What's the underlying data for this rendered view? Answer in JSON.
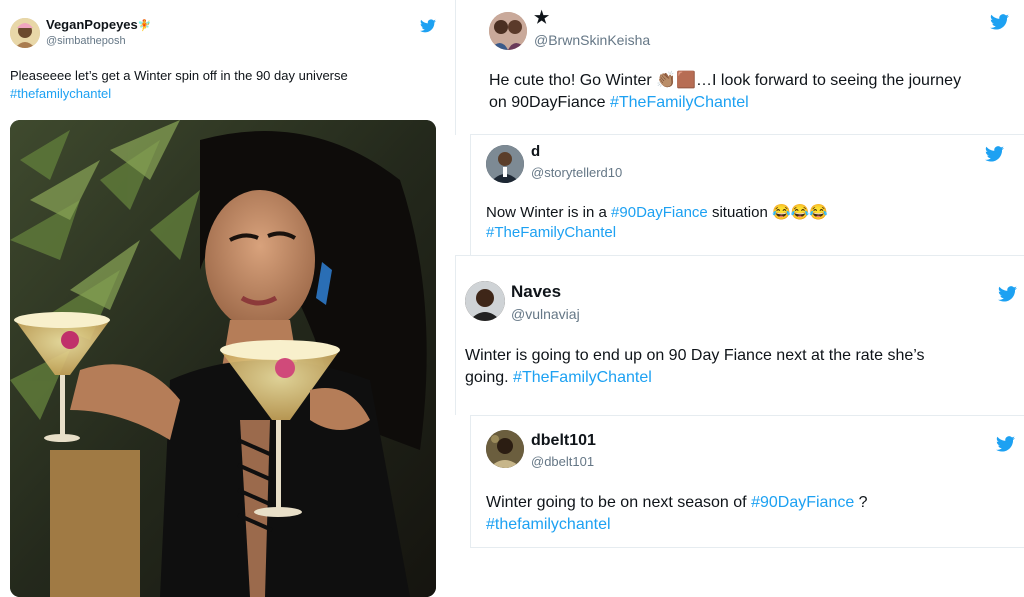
{
  "colors": {
    "accent": "#1da1f2",
    "muted": "#657786",
    "text": "#0f1419",
    "divider": "#e6ecf0"
  },
  "tweet1": {
    "name": "VeganPopeyes",
    "name_emoji": "🧚",
    "handle": "@simbatheposh",
    "text": "Pleaseeee let’s get a Winter spin off in the 90 day universe",
    "hashtag": "#thefamilychantel",
    "icon": "twitter-bird-icon"
  },
  "tweet2": {
    "name": "★",
    "handle": "@BrwnSkinKeisha",
    "text_before": "He cute tho! Go Winter ",
    "emoji_clap": "👏🏽",
    "emoji_square": "🟫",
    "text_after": "…I look forward to seeing the journey",
    "text_line2": "on 90DayFiance ",
    "hashtag": "#TheFamilyChantel"
  },
  "tweet3": {
    "name": "d",
    "handle": "@storytellerd10",
    "text_before": "Now Winter is in a ",
    "hashtag1": "#90DayFiance",
    "text_after": " situation ",
    "emojis": "😂😂😂",
    "hashtag2": "#TheFamilyChantel"
  },
  "tweet4": {
    "name": "Naves",
    "handle": "@vulnaviaj",
    "text_line1": "Winter is going to end up on 90 Day Fiance next at the rate she’s",
    "text_line2": "going. ",
    "hashtag": "#TheFamilyChantel"
  },
  "tweet5": {
    "name": "dbelt101",
    "handle": "@dbelt101",
    "text_before": "Winter going to be on next season of ",
    "hashtag1": "#90DayFiance",
    "text_after": " ?",
    "hashtag2": "#thefamilychantel"
  }
}
